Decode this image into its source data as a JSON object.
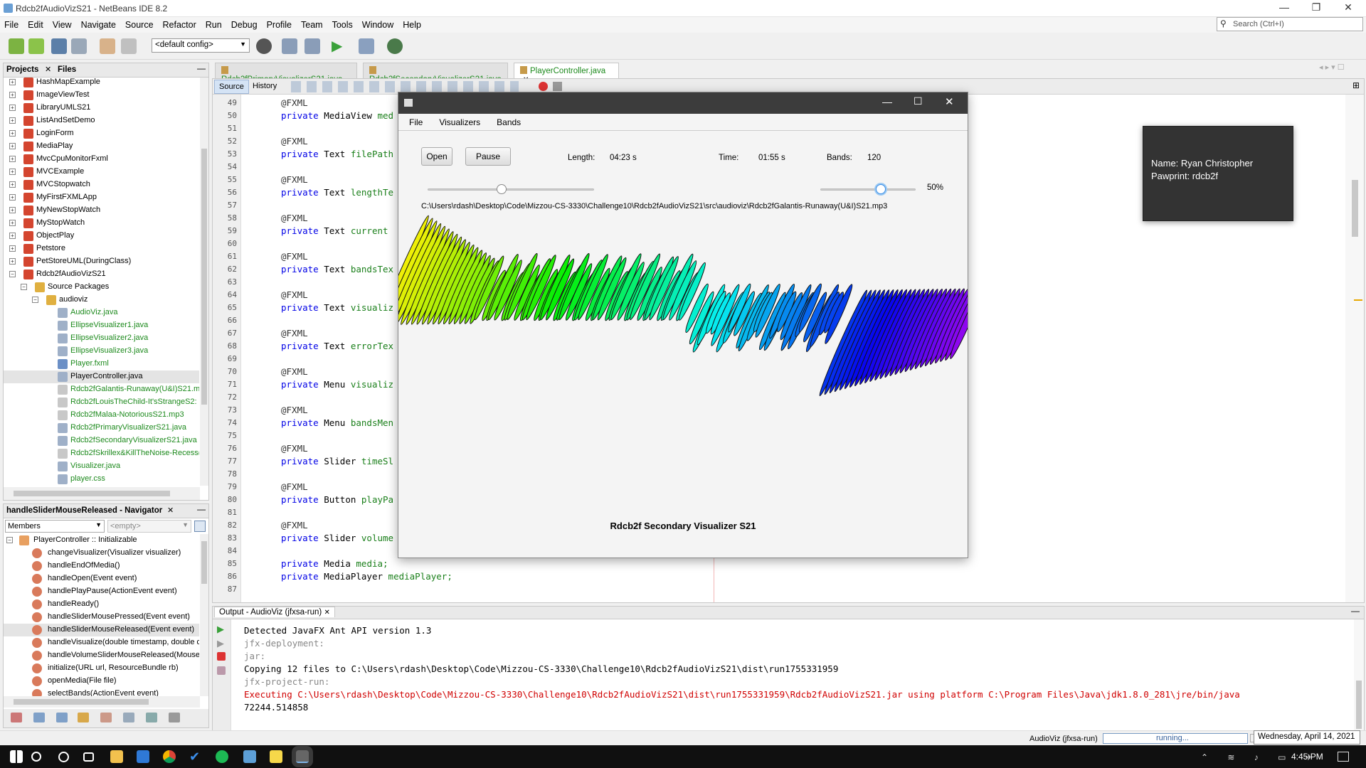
{
  "window": {
    "title": "Rdcb2fAudioVizS21 - NetBeans IDE 8.2"
  },
  "menu": [
    "File",
    "Edit",
    "View",
    "Navigate",
    "Source",
    "Refactor",
    "Run",
    "Debug",
    "Profile",
    "Team",
    "Tools",
    "Window",
    "Help"
  ],
  "search": {
    "placeholder": "Search (Ctrl+I)"
  },
  "toolbar": {
    "config": "<default config>"
  },
  "projects_panel": {
    "tabs": [
      "Projects",
      "Files"
    ],
    "items": [
      {
        "label": "HashMapExample",
        "depth": 0,
        "icon": "project-icon"
      },
      {
        "label": "ImageViewTest",
        "depth": 0,
        "icon": "project-icon"
      },
      {
        "label": "LibraryUMLS21",
        "depth": 0,
        "icon": "project-icon"
      },
      {
        "label": "ListAndSetDemo",
        "depth": 0,
        "icon": "project-icon"
      },
      {
        "label": "LoginForm",
        "depth": 0,
        "icon": "project-icon"
      },
      {
        "label": "MediaPlay",
        "depth": 0,
        "icon": "project-icon"
      },
      {
        "label": "MvcCpuMonitorFxml",
        "depth": 0,
        "icon": "project-icon"
      },
      {
        "label": "MVCExample",
        "depth": 0,
        "icon": "project-icon"
      },
      {
        "label": "MVCStopwatch",
        "depth": 0,
        "icon": "project-icon"
      },
      {
        "label": "MyFirstFXMLApp",
        "depth": 0,
        "icon": "project-icon"
      },
      {
        "label": "MyNewStopWatch",
        "depth": 0,
        "icon": "project-icon"
      },
      {
        "label": "MyStopWatch",
        "depth": 0,
        "icon": "project-icon"
      },
      {
        "label": "ObjectPlay",
        "depth": 0,
        "icon": "project-icon"
      },
      {
        "label": "Petstore",
        "depth": 0,
        "icon": "project-icon"
      },
      {
        "label": "PetStoreUML(DuringClass)",
        "depth": 0,
        "icon": "project-icon"
      },
      {
        "label": "Rdcb2fAudioVizS21",
        "depth": 0,
        "icon": "project-icon"
      },
      {
        "label": "Source Packages",
        "depth": 1,
        "icon": "folder-icon"
      },
      {
        "label": "audioviz",
        "depth": 2,
        "icon": "package-icon"
      },
      {
        "label": "AudioViz.java",
        "depth": 3,
        "icon": "java-file-icon",
        "green": true
      },
      {
        "label": "EllipseVisualizer1.java",
        "depth": 3,
        "icon": "java-file-icon",
        "green": true
      },
      {
        "label": "EllipseVisualizer2.java",
        "depth": 3,
        "icon": "java-file-icon",
        "green": true
      },
      {
        "label": "EllipseVisualizer3.java",
        "depth": 3,
        "icon": "java-file-icon",
        "green": true
      },
      {
        "label": "Player.fxml",
        "depth": 3,
        "icon": "fxml-file-icon",
        "green": true
      },
      {
        "label": "PlayerController.java",
        "depth": 3,
        "icon": "java-file-icon",
        "selected": true
      },
      {
        "label": "Rdcb2fGalantis-Runaway(U&I)S21.m",
        "depth": 3,
        "icon": "file-icon",
        "green": true
      },
      {
        "label": "Rdcb2fLouisTheChild-It'sStrangeS2:",
        "depth": 3,
        "icon": "file-icon",
        "green": true
      },
      {
        "label": "Rdcb2fMalaa-NotoriousS21.mp3",
        "depth": 3,
        "icon": "file-icon",
        "green": true
      },
      {
        "label": "Rdcb2fPrimaryVisualizerS21.java",
        "depth": 3,
        "icon": "java-file-icon",
        "green": true
      },
      {
        "label": "Rdcb2fSecondaryVisualizerS21.java",
        "depth": 3,
        "icon": "java-file-icon",
        "green": true
      },
      {
        "label": "Rdcb2fSkrillex&KillTheNoise-Recess(",
        "depth": 3,
        "icon": "file-icon",
        "green": true
      },
      {
        "label": "Visualizer.java",
        "depth": 3,
        "icon": "java-file-icon",
        "green": true
      },
      {
        "label": "player.css",
        "depth": 3,
        "icon": "css-file-icon",
        "green": true
      }
    ]
  },
  "navigator": {
    "title": "handleSliderMouseReleased - Navigator",
    "members_label": "Members",
    "filter_placeholder": "<empty>",
    "root": "PlayerController :: Initializable",
    "items": [
      "changeVisualizer(Visualizer visualizer)",
      "handleEndOfMedia()",
      "handleOpen(Event event)",
      "handlePlayPause(ActionEvent event)",
      "handleReady()",
      "handleSliderMousePressed(Event event)",
      "handleSliderMouseReleased(Event event)",
      "handleVisualize(double timestamp, double d",
      "handleVolumeSliderMouseReleased(MouseE",
      "initialize(URL url, ResourceBundle rb)",
      "openMedia(File file)",
      "selectBands(ActionEvent event)"
    ]
  },
  "editor": {
    "tabs": [
      "Rdcb2fPrimaryVisualizerS21.java",
      "Rdcb2fSecondaryVisualizerS21.java",
      "PlayerController.java"
    ],
    "subtabs": [
      "Source",
      "History"
    ],
    "lines": [
      {
        "n": "49",
        "text": "@FXML",
        "type": "at"
      },
      {
        "n": "50",
        "text": "private MediaView med",
        "type": "field"
      },
      {
        "n": "51",
        "text": "",
        "type": "blank"
      },
      {
        "n": "52",
        "text": "@FXML",
        "type": "at"
      },
      {
        "n": "53",
        "text": "private Text filePath",
        "type": "field"
      },
      {
        "n": "54",
        "text": "",
        "type": "blank"
      },
      {
        "n": "55",
        "text": "@FXML",
        "type": "at"
      },
      {
        "n": "56",
        "text": "private Text lengthTe",
        "type": "field"
      },
      {
        "n": "57",
        "text": "",
        "type": "blank"
      },
      {
        "n": "58",
        "text": "@FXML",
        "type": "at"
      },
      {
        "n": "59",
        "text": "private Text current",
        "type": "field"
      },
      {
        "n": "60",
        "text": "",
        "type": "blank"
      },
      {
        "n": "61",
        "text": "@FXML",
        "type": "at"
      },
      {
        "n": "62",
        "text": "private Text bandsTex",
        "type": "field"
      },
      {
        "n": "63",
        "text": "",
        "type": "blank"
      },
      {
        "n": "64",
        "text": "@FXML",
        "type": "at"
      },
      {
        "n": "65",
        "text": "private Text visualiz",
        "type": "field"
      },
      {
        "n": "66",
        "text": "",
        "type": "blank"
      },
      {
        "n": "67",
        "text": "@FXML",
        "type": "at"
      },
      {
        "n": "68",
        "text": "private Text errorTex",
        "type": "field"
      },
      {
        "n": "69",
        "text": "",
        "type": "blank"
      },
      {
        "n": "70",
        "text": "@FXML",
        "type": "at"
      },
      {
        "n": "71",
        "text": "private Menu visualiz",
        "type": "field"
      },
      {
        "n": "72",
        "text": "",
        "type": "blank"
      },
      {
        "n": "73",
        "text": "@FXML",
        "type": "at"
      },
      {
        "n": "74",
        "text": "private Menu bandsMen",
        "type": "field"
      },
      {
        "n": "75",
        "text": "",
        "type": "blank"
      },
      {
        "n": "76",
        "text": "@FXML",
        "type": "at"
      },
      {
        "n": "77",
        "text": "private Slider timeSl",
        "type": "field"
      },
      {
        "n": "78",
        "text": "",
        "type": "blank"
      },
      {
        "n": "79",
        "text": "@FXML",
        "type": "at"
      },
      {
        "n": "80",
        "text": "private Button playPa",
        "type": "field"
      },
      {
        "n": "81",
        "text": "",
        "type": "blank"
      },
      {
        "n": "82",
        "text": "@FXML",
        "type": "at"
      },
      {
        "n": "83",
        "text": "private Slider volume",
        "type": "field"
      },
      {
        "n": "84",
        "text": "",
        "type": "blank"
      },
      {
        "n": "85",
        "text": "private Media media;",
        "type": "field"
      },
      {
        "n": "86",
        "text": "private MediaPlayer mediaPlayer;",
        "type": "field"
      },
      {
        "n": "87",
        "text": "",
        "type": "blank"
      }
    ]
  },
  "tooltip": {
    "name": "Name: Ryan Christopher",
    "pawprint": "Pawprint: rdcb2f"
  },
  "app": {
    "menu": [
      "File",
      "Visualizers",
      "Bands"
    ],
    "open_label": "Open",
    "pause_label": "Pause",
    "length_label": "Length:",
    "length_value": "04:23 s",
    "time_label": "Time:",
    "time_value": "01:55 s",
    "bands_label": "Bands:",
    "bands_value": "120",
    "time_slider_fraction": 0.44,
    "volume_percent": "50%",
    "volume_fraction": 0.5,
    "file_path": "C:\\Users\\rdash\\Desktop\\Code\\Mizzou-CS-3330\\Challenge10\\Rdcb2fAudioVizS21\\src\\audioviz\\Rdcb2fGalantis-Runaway(U&I)S21.mp3",
    "visualizer_name": "Rdcb2f Secondary Visualizer S21"
  },
  "output": {
    "tab": "Output - AudioViz (jfxsa-run)",
    "lines": [
      {
        "text": "Detected JavaFX Ant API version 1.3",
        "color": "#000000"
      },
      {
        "text": "jfx-deployment:",
        "color": "#888888"
      },
      {
        "text": "jar:",
        "color": "#888888"
      },
      {
        "text": "Copying 12 files to C:\\Users\\rdash\\Desktop\\Code\\Mizzou-CS-3330\\Challenge10\\Rdcb2fAudioVizS21\\dist\\run1755331959",
        "color": "#000000"
      },
      {
        "text": "jfx-project-run:",
        "color": "#888888"
      },
      {
        "text": "Executing C:\\Users\\rdash\\Desktop\\Code\\Mizzou-CS-3330\\Challenge10\\Rdcb2fAudioVizS21\\dist\\run1755331959\\Rdcb2fAudioVizS21.jar using platform C:\\Program Files\\Java\\jdk1.8.0_281\\jre/bin/java",
        "color": "#d00000"
      },
      {
        "text": "72244.514858",
        "color": "#000000"
      }
    ]
  },
  "statusbar": {
    "task": "AudioViz (jfxsa-run)",
    "progress": "running...",
    "date_tip": "Wednesday, April 14, 2021"
  },
  "taskbar": {
    "time": "4:45 PM"
  },
  "colors": {
    "accent": "#1c6bb0",
    "app_title": "#3c3c3c"
  }
}
